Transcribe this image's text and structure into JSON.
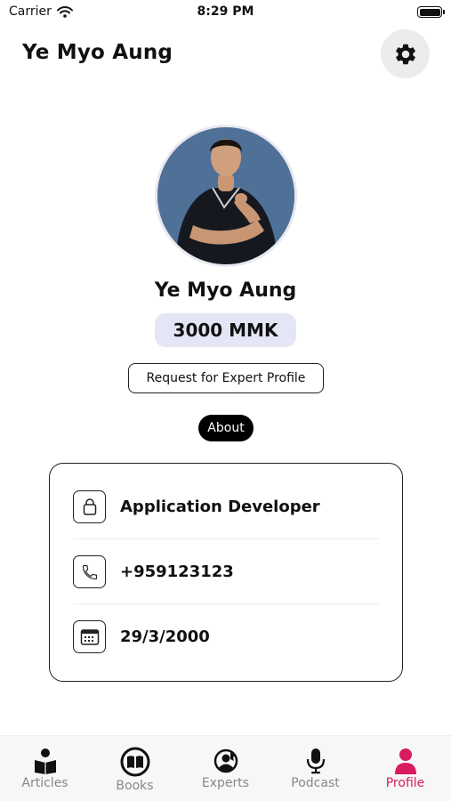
{
  "status_bar": {
    "carrier": "Carrier",
    "time": "8:29 PM"
  },
  "header": {
    "title": "Ye Myo Aung"
  },
  "profile": {
    "name": "Ye Myo Aung",
    "balance": "3000 MMK",
    "expert_request_label": "Request for Expert Profile",
    "about_label": "About"
  },
  "info": [
    {
      "icon": "briefcase-icon",
      "text": "Application Developer"
    },
    {
      "icon": "phone-icon",
      "text": "+959123123"
    },
    {
      "icon": "calendar-icon",
      "text": "29/3/2000"
    }
  ],
  "tabs": [
    {
      "label": "Articles",
      "icon": "reader-icon"
    },
    {
      "label": "Books",
      "icon": "book-icon"
    },
    {
      "label": "Experts",
      "icon": "expert-icon"
    },
    {
      "label": "Podcast",
      "icon": "microphone-icon"
    },
    {
      "label": "Profile",
      "icon": "person-icon",
      "active": true
    }
  ],
  "colors": {
    "accent": "#d81b60",
    "badge_bg": "#e4e6f5",
    "pill_bg": "#000000"
  }
}
